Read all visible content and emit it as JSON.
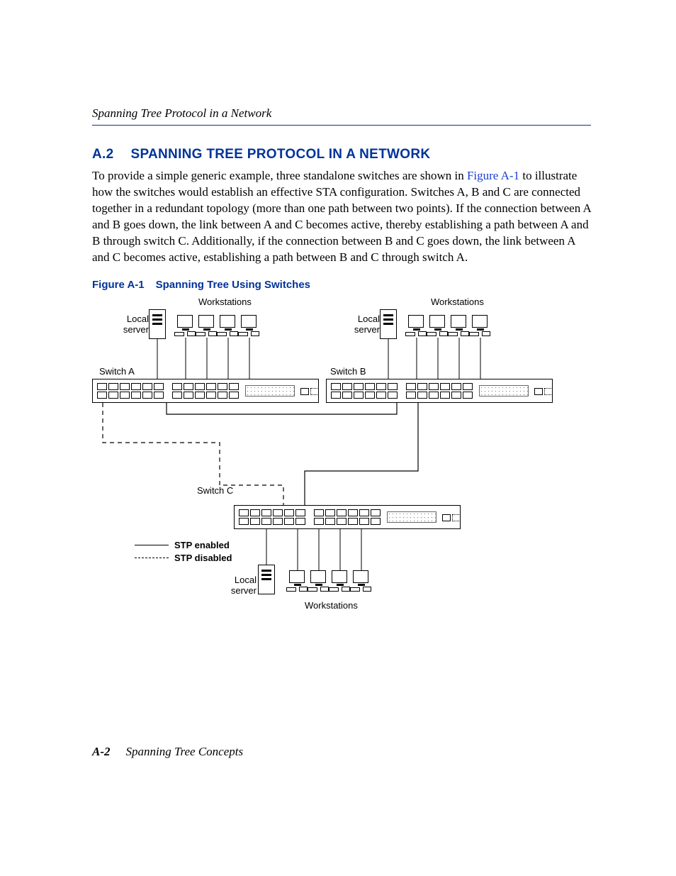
{
  "header": {
    "running_title": "Spanning Tree Protocol in a Network"
  },
  "section": {
    "number": "A.2",
    "title": "SPANNING TREE PROTOCOL IN A NETWORK"
  },
  "paragraph": {
    "pre_link": "To provide a simple generic example, three standalone switches are shown in ",
    "link_text": "Figure A-1",
    "post_link": " to illustrate how the switches would establish an effective STA configuration. Switches A, B and C are connected together in a redundant topology (more than one path between two points). If the connection between A and B goes down, the link between A and C becomes active, thereby establishing a path between A and B through switch C. Additionally, if the connection between B and C goes down, the link between A and C becomes active, establishing a path between B and C through switch A."
  },
  "figure": {
    "number": "Figure A-1",
    "title": "Spanning Tree Using Switches",
    "labels": {
      "workstations_top_left": "Workstations",
      "workstations_top_right": "Workstations",
      "workstations_bottom": "Workstations",
      "local_server_a": "Local\nserver",
      "local_server_b": "Local\nserver",
      "local_server_c": "Local\nserver",
      "switch_a": "Switch A",
      "switch_b": "Switch B",
      "switch_c": "Switch C"
    },
    "legend": {
      "enabled": "STP enabled",
      "disabled": "STP disabled"
    }
  },
  "footer": {
    "page_number": "A-2",
    "chapter_title": "Spanning Tree Concepts"
  }
}
